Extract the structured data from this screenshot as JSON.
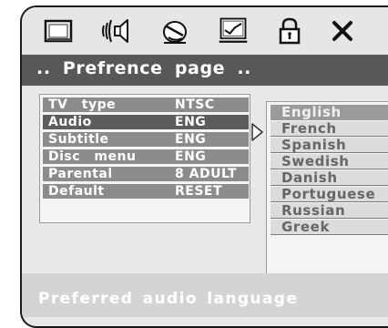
{
  "icons": [
    "tv-icon",
    "audio-icon",
    "subtitle-icon",
    "disc-menu-icon",
    "lock-icon",
    "close-icon"
  ],
  "title": ".. Prefrence  page ..",
  "menu": [
    {
      "label": "TV  type",
      "value": "NTSC"
    },
    {
      "label": "Audio",
      "value": "ENG"
    },
    {
      "label": "Subtitle",
      "value": "ENG"
    },
    {
      "label": "Disc menu",
      "value": "ENG"
    },
    {
      "label": "Parental",
      "value": "8 ADULT"
    },
    {
      "label": "Default",
      "value": "RESET"
    }
  ],
  "selected_menu": "Audio",
  "options": [
    "English",
    "French",
    "Spanish",
    "Swedish",
    "Danish",
    "Portuguese",
    "Russian",
    "Greek"
  ],
  "selected_option": "English",
  "status": "Preferred audio language",
  "colors": {
    "title_bar": "#585858",
    "menu_row": "#8c8c8c",
    "menu_row_selected": "#5c5c5c",
    "option_row": "#dcdcdc",
    "option_selected": "#9a9a9a",
    "status_bar": "#d4d4d4"
  }
}
